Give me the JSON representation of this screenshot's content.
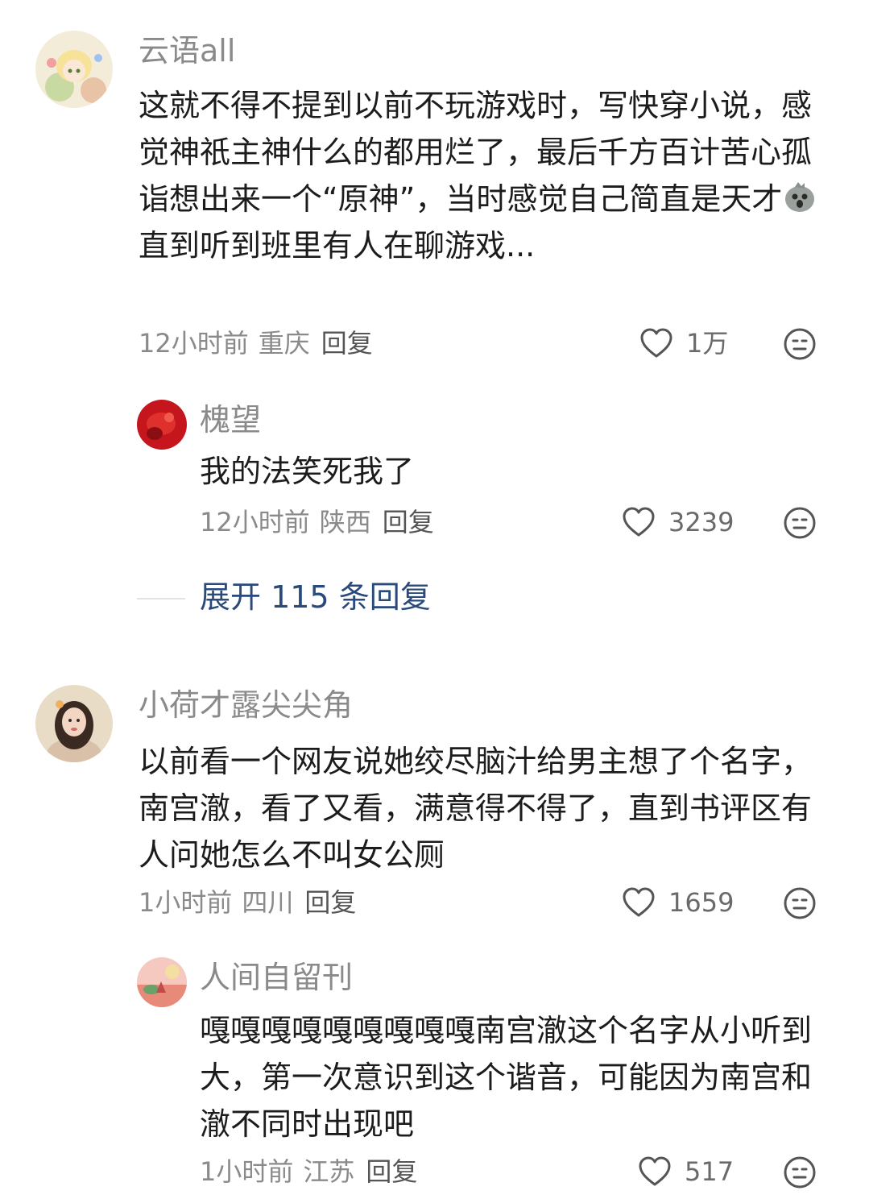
{
  "comments": [
    {
      "user": "云语all",
      "text_before_emoji": "这就不得不提到以前不玩游戏时，写快穿小说，感觉神祇主神什么的都用烂了，最后千方百计苦心孤诣想出来一个“原神”，当时感觉自己简直是天才",
      "emoji": "chick-emoji",
      "text_after_emoji": "直到听到班里有人在聊游戏...",
      "time": "12小时前",
      "location": "重庆",
      "reply_label": "回复",
      "likes": "1万",
      "replies": [
        {
          "user": "槐望",
          "text": "我的法笑死我了",
          "time": "12小时前",
          "location": "陕西",
          "reply_label": "回复",
          "likes": "3239"
        }
      ],
      "expand_label": "展开 115 条回复"
    },
    {
      "user": "小荷才露尖尖角",
      "text": "以前看一个网友说她绞尽脑汁给男主想了个名字，南宫澈，看了又看，满意得不得了，直到书评区有人问她怎么不叫女公厕",
      "time": "1小时前",
      "location": "四川",
      "reply_label": "回复",
      "likes": "1659",
      "replies": [
        {
          "user": "人间自留刊",
          "text": "嘎嘎嘎嘎嘎嘎嘎嘎嘎南宫澈这个名字从小听到大，第一次意识到这个谐音，可能因为南宫和澈不同时出现吧",
          "time": "1小时前",
          "location": "江苏",
          "reply_label": "回复",
          "likes": "517"
        }
      ]
    }
  ],
  "icons": {
    "like": "heart-outline-icon",
    "dislike": "meh-face-icon"
  },
  "colors": {
    "username": "#8a8a8a",
    "text": "#1c1c1c",
    "expand_link": "#2a4a7c"
  }
}
